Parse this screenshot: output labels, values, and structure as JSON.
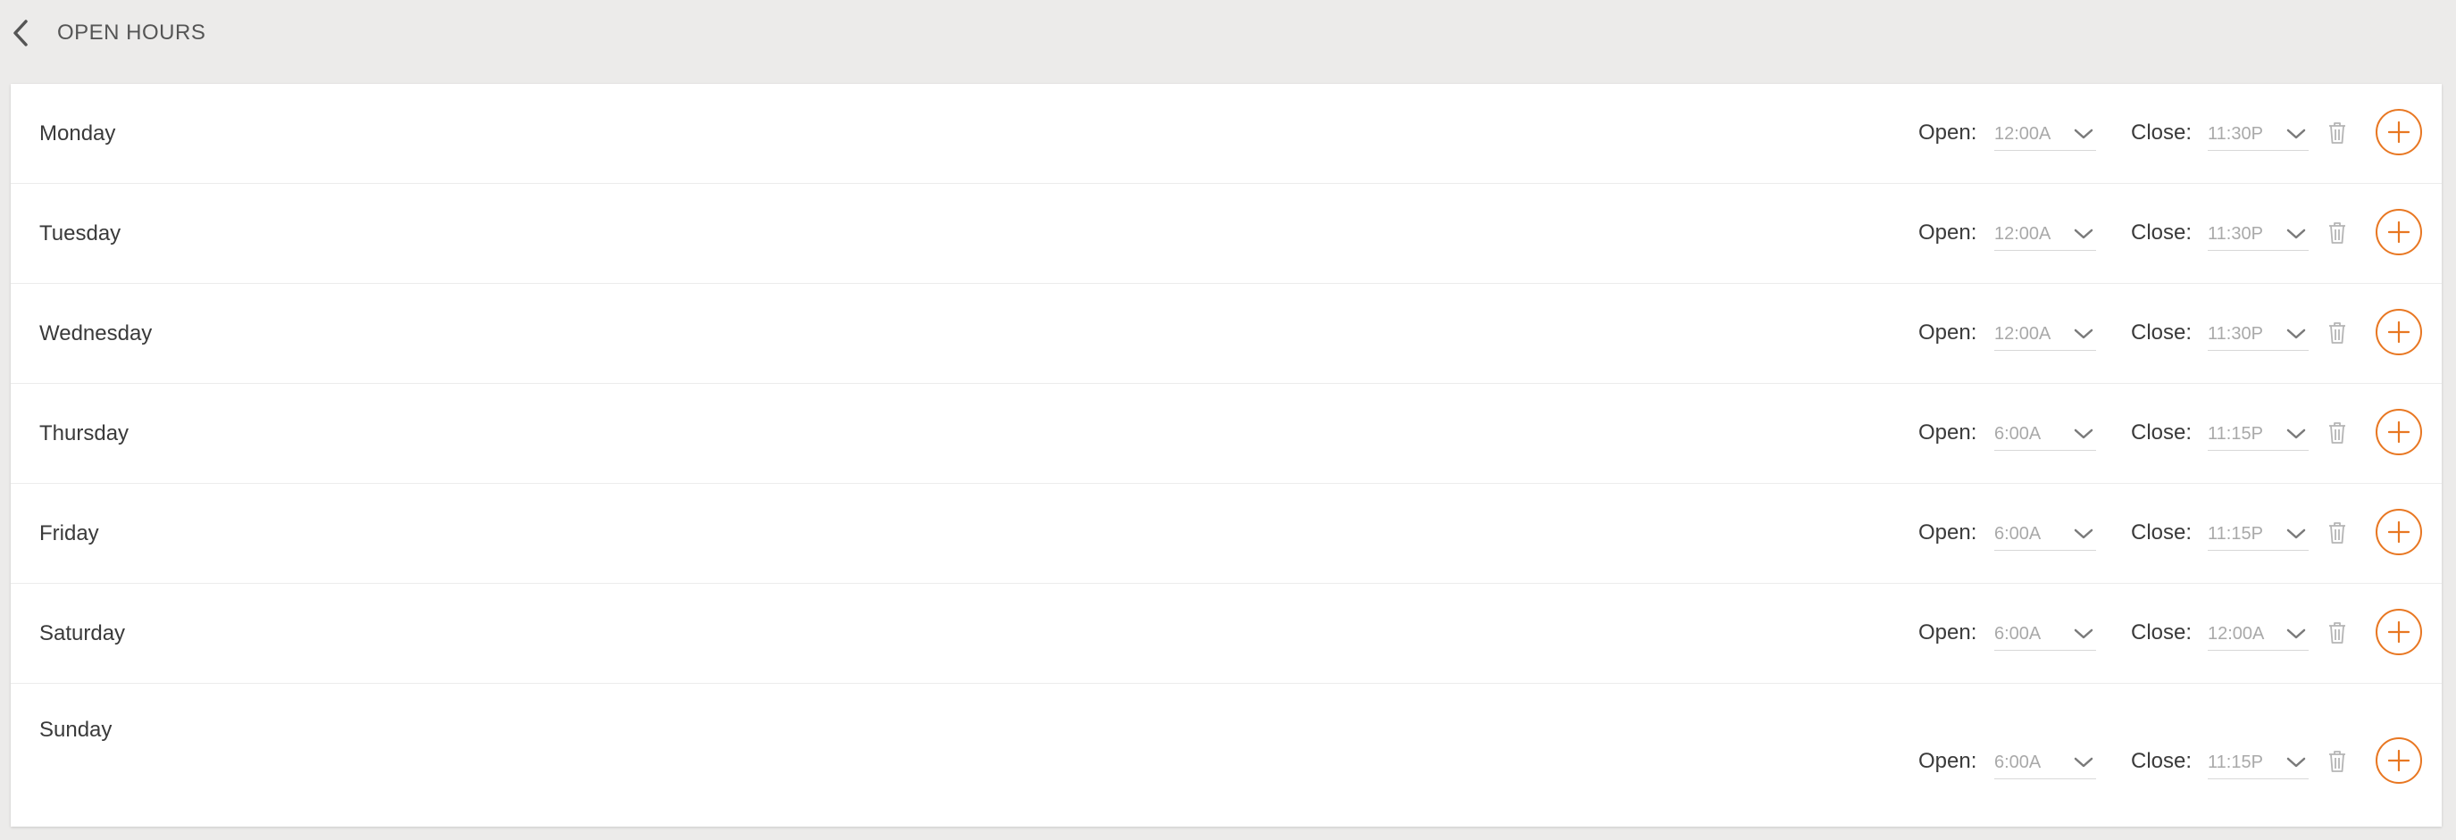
{
  "header": {
    "title": "OPEN HOURS"
  },
  "labels": {
    "open": "Open:",
    "close": "Close:"
  },
  "colors": {
    "accent": "#e87722",
    "background": "#ecebea",
    "card": "#ffffff"
  },
  "days": [
    {
      "name": "Monday",
      "open": "12:00A",
      "close": "11:30P"
    },
    {
      "name": "Tuesday",
      "open": "12:00A",
      "close": "11:30P"
    },
    {
      "name": "Wednesday",
      "open": "12:00A",
      "close": "11:30P"
    },
    {
      "name": "Thursday",
      "open": "6:00A",
      "close": "11:15P"
    },
    {
      "name": "Friday",
      "open": "6:00A",
      "close": "11:15P"
    },
    {
      "name": "Saturday",
      "open": "6:00A",
      "close": "12:00A"
    },
    {
      "name": "Sunday",
      "open": "6:00A",
      "close": "11:15P"
    }
  ],
  "icons": {
    "back": "chevron-left-icon",
    "dropdown": "chevron-down-icon",
    "delete": "trash-icon",
    "add": "plus-circle-icon"
  }
}
